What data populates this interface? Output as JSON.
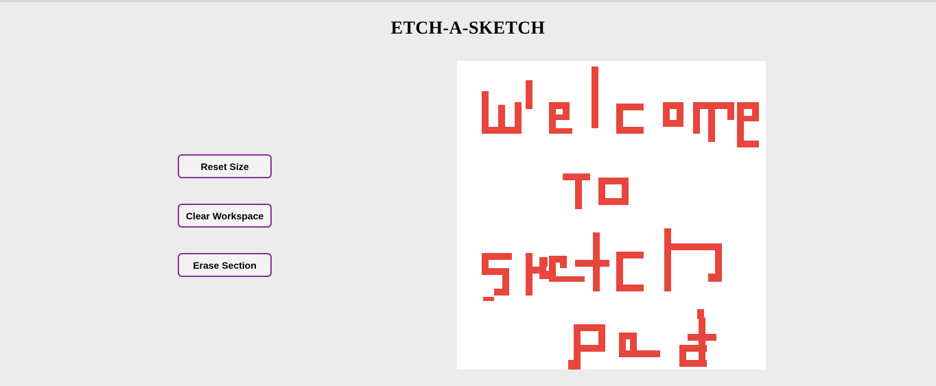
{
  "app": {
    "title": "ETCH-A-SKETCH"
  },
  "controls": {
    "reset_size": "Reset Size",
    "clear_workspace": "Clear Workspace",
    "erase_section": "Erase Section"
  },
  "colors": {
    "page_background": "#ececec",
    "button_border": "#8b2f9c",
    "pad_background": "#ffffff",
    "pen_color": "#e8453c"
  },
  "sketch_pad": {
    "drawing_text": "welcome to sketch pad"
  }
}
